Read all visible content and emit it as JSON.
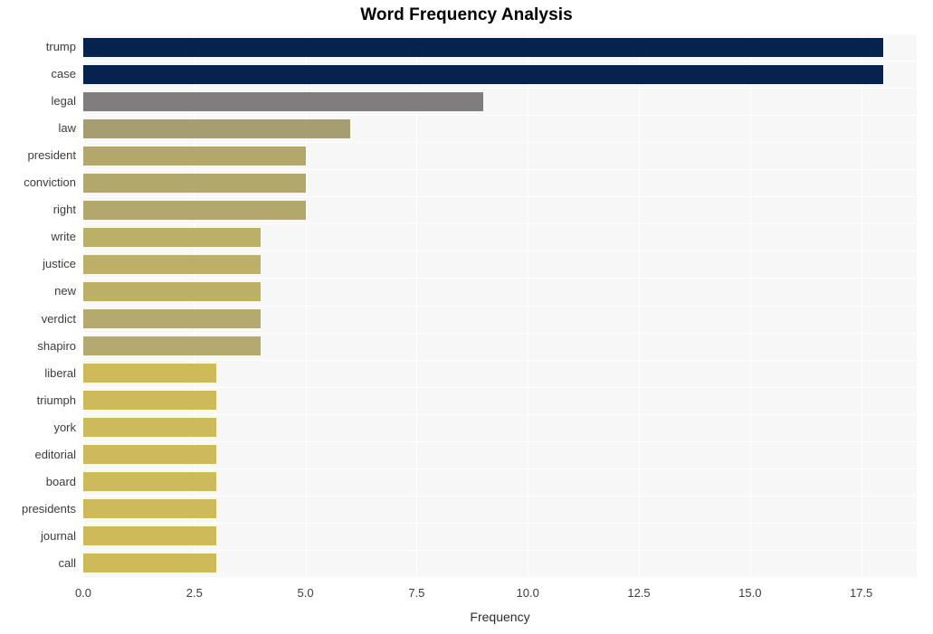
{
  "chart_data": {
    "type": "bar",
    "orientation": "horizontal",
    "title": "Word Frequency Analysis",
    "xlabel": "Frequency",
    "ylabel": "",
    "categories": [
      "trump",
      "case",
      "legal",
      "law",
      "president",
      "conviction",
      "right",
      "write",
      "justice",
      "new",
      "verdict",
      "shapiro",
      "liberal",
      "triumph",
      "york",
      "editorial",
      "board",
      "presidents",
      "journal",
      "call"
    ],
    "values": [
      18,
      18,
      9,
      6,
      5,
      5,
      5,
      4,
      4,
      4,
      4,
      4,
      3,
      3,
      3,
      3,
      3,
      3,
      3,
      3
    ],
    "bar_colors": [
      "#06234f",
      "#06234f",
      "#7f7d7d",
      "#a69d72",
      "#b2a86c",
      "#b2a86c",
      "#b2a86c",
      "#bcb069",
      "#bcb069",
      "#bcb069",
      "#b5aa6d",
      "#b4a96e",
      "#ceba5b",
      "#ceba5b",
      "#cdba5c",
      "#cdba5c",
      "#cdba5c",
      "#ceba5b",
      "#ceba5b",
      "#ceba5b"
    ],
    "xlim": [
      0,
      18.75
    ],
    "xticks": [
      0,
      2.5,
      5,
      7.5,
      10,
      12.5,
      15,
      17.5
    ],
    "xtick_labels": [
      "0.0",
      "2.5",
      "5.0",
      "7.5",
      "10.0",
      "12.5",
      "15.0",
      "17.5"
    ],
    "grid": true,
    "grid_color": "#ffffff",
    "plot_background": "#f7f7f7",
    "figure_background": "#ffffff",
    "legend": null
  }
}
